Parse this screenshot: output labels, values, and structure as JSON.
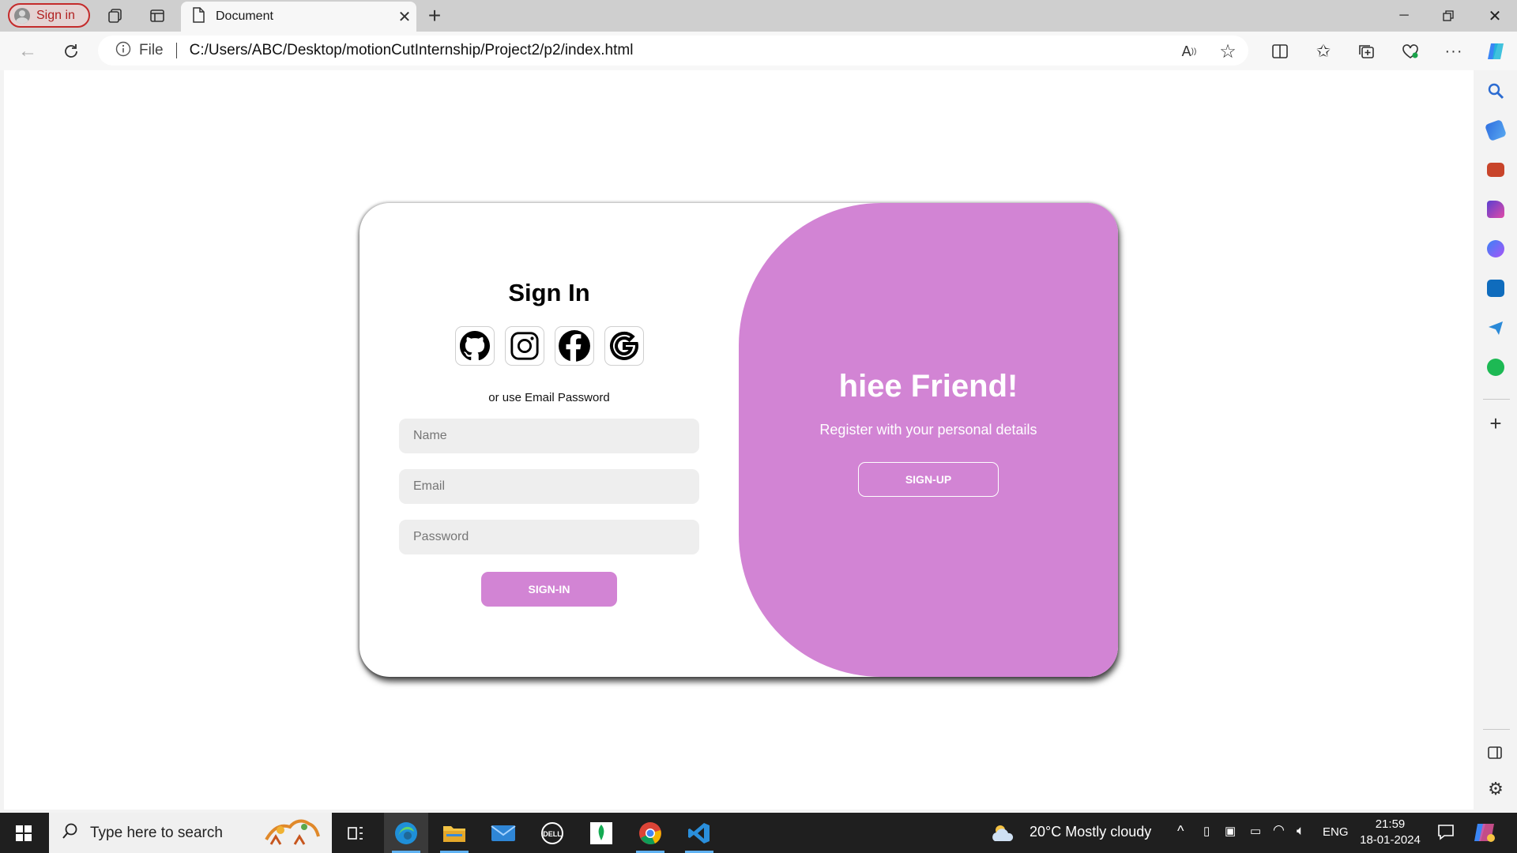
{
  "browser": {
    "profile_label": "Sign in",
    "tab_title": "Document",
    "url_scheme_label": "File",
    "url": "C:/Users/ABC/Desktop/motionCutInternship/Project2/p2/index.html"
  },
  "signin": {
    "title": "Sign In",
    "social": [
      "github-icon",
      "instagram-icon",
      "facebook-icon",
      "google-icon"
    ],
    "alt_text": "or use Email Password",
    "name_placeholder": "Name",
    "email_placeholder": "Email",
    "password_placeholder": "Password",
    "button": "SIGN-IN"
  },
  "toggle": {
    "title": "hiee Friend!",
    "text": "Register with your personal details",
    "button": "SIGN-UP"
  },
  "taskbar": {
    "search_placeholder": "Type here to search",
    "weather": "20°C  Mostly cloudy",
    "language": "ENG",
    "time": "21:59",
    "date": "18-01-2024"
  },
  "colors": {
    "accent": "#d284d4",
    "page": "#ffffff",
    "field_bg": "#eeeeee"
  }
}
